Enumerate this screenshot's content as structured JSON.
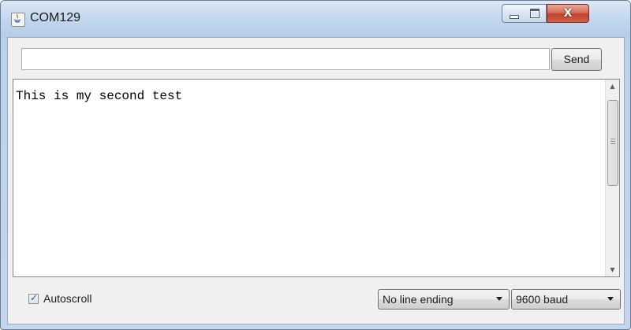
{
  "window": {
    "title": "COM129",
    "icon": "java-icon"
  },
  "controls": {
    "minimize_icon": "minimize-icon",
    "maximize_icon": "maximize-icon",
    "close_label": "X"
  },
  "send": {
    "input_value": "",
    "button_label": "Send"
  },
  "output": {
    "text": "This is my second test"
  },
  "footer": {
    "autoscroll_label": "Autoscroll",
    "autoscroll_checked": true,
    "line_ending_selected": "No line ending",
    "baud_selected": "9600 baud"
  }
}
